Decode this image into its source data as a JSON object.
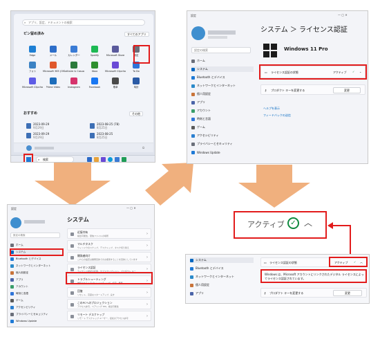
{
  "start_menu": {
    "search_placeholder": "アプリ、設定、ドキュメントの検索",
    "pinned_title": "ピン留め済み",
    "all_apps_button": "すべてのアプリ",
    "apps": [
      {
        "label": "Edge",
        "color": "#1e7fd4"
      },
      {
        "label": "メール",
        "color": "#2d6ec9"
      },
      {
        "label": "カレンダー",
        "color": "#3a7bd5"
      },
      {
        "label": "Spotify",
        "color": "#1db954"
      },
      {
        "label": "Microsoft Store",
        "color": "#5a5a9c"
      },
      {
        "label": "設定",
        "color": "#6b6f7a"
      },
      {
        "label": "フォト",
        "color": "#3b82c4"
      },
      {
        "label": "Microsoft 365 (Office)",
        "color": "#e0582b"
      },
      {
        "label": "Solitaire & Casual Games",
        "color": "#2b7a3b"
      },
      {
        "label": "Xbox",
        "color": "#2f8f2f"
      },
      {
        "label": "Microsoft Clipchamp",
        "color": "#6a4ad6"
      },
      {
        "label": "To Do",
        "color": "#2f74d8"
      },
      {
        "label": "Microsoft Clipchamp",
        "color": "#5e5ce6"
      },
      {
        "label": "Prime Video",
        "color": "#1c6dbb"
      },
      {
        "label": "Instagram",
        "color": "#d6336c"
      },
      {
        "label": "Facebook",
        "color": "#1877f2"
      },
      {
        "label": "電卓",
        "color": "#4a4a4a"
      },
      {
        "label": "時計",
        "color": "#2a5aa5"
      }
    ],
    "recommended_title": "おすすめ",
    "more_button": "その他",
    "recent": [
      {
        "date": "2023-09-29",
        "sub": "9月29日"
      },
      {
        "date": "2023-09-29",
        "sub": "9月29日"
      },
      {
        "date": "2023-08-25 (78)",
        "sub": "8月25日"
      },
      {
        "date": "2023-08-25",
        "sub": "8月25日"
      }
    ],
    "taskbar_search": "検索"
  },
  "license_page": {
    "window_title": "設定",
    "breadcrumb": "システム ＞ ライセンス認証",
    "edition": "Windows 11 Pro",
    "search_placeholder": "設定の検索",
    "nav": [
      "ホーム",
      "システム",
      "Bluetooth とデバイス",
      "ネットワークとインターネット",
      "個人用設定",
      "アプリ",
      "アカウント",
      "時刻と言語",
      "ゲーム",
      "アクセシビリティ",
      "プライバシーとセキュリティ",
      "Windows Update"
    ],
    "activation_state_label": "ライセンス認証の状態",
    "activation_state_value": "アクティブ",
    "product_key_label": "プロダクト キーを変更する",
    "change_button": "変更",
    "help_link": "ヘルプを表示",
    "feedback_link": "フィードバックの送信"
  },
  "system_page": {
    "window_title": "設定",
    "heading": "システム",
    "search_placeholder": "設定の検索",
    "nav": [
      "ホーム",
      "システム",
      "Bluetooth とデバイス",
      "ネットワークとインターネット",
      "個人用設定",
      "アプリ",
      "アカウント",
      "時刻と言語",
      "ゲーム",
      "アクセシビリティ",
      "プライバシーとセキュリティ",
      "Windows Update"
    ],
    "items": [
      {
        "title": "近接共有",
        "sub": "検出可能性、受信ファイルの場所"
      },
      {
        "title": "マルチタスク",
        "sub": "ウィンドウのスナップ、デスクトップ、タスク切り替え"
      },
      {
        "title": "開発者向け",
        "sub": "これらの設定は開発目的でのみ使用することを目的としています"
      },
      {
        "title": "ライセンス認証",
        "sub": "ライセンス認証の状態、サブスクリプション、プロダクト キー"
      },
      {
        "title": "トラブルシューティング",
        "sub": "推奨されるトラブルシューティング、設定、履歴"
      },
      {
        "title": "回復",
        "sub": "リセット、高度なスタートアップ、戻す"
      },
      {
        "title": "このPCへのプロジェクション",
        "sub": "アクセス許可、ペアリング PIN、検出可能性"
      },
      {
        "title": "リモート デスクトップ",
        "sub": "リモート デスクトップ ユーザー、接続のアクセス許可"
      }
    ]
  },
  "zoom_callout": {
    "status_text": "アクティブ"
  },
  "detail_panel": {
    "nav": [
      "システム",
      "Bluetooth とデバイス",
      "ネットワークとインターネット",
      "個人用設定",
      "アプリ"
    ],
    "activation_state_label": "ライセンス認証の状態",
    "activation_state_value": "アクティブ",
    "message": "Windows は、Microsoft アカウントにリンクされたデジタル ライセンスによってライセンス認証されています。",
    "product_key_label": "プロダクト キーを変更する",
    "change_button": "変更"
  },
  "colors": {
    "highlight_red": "#e21b1b",
    "arrow_orange": "#f0b07e",
    "accent_blue": "#0067c0",
    "active_green": "#0f8a3f"
  }
}
